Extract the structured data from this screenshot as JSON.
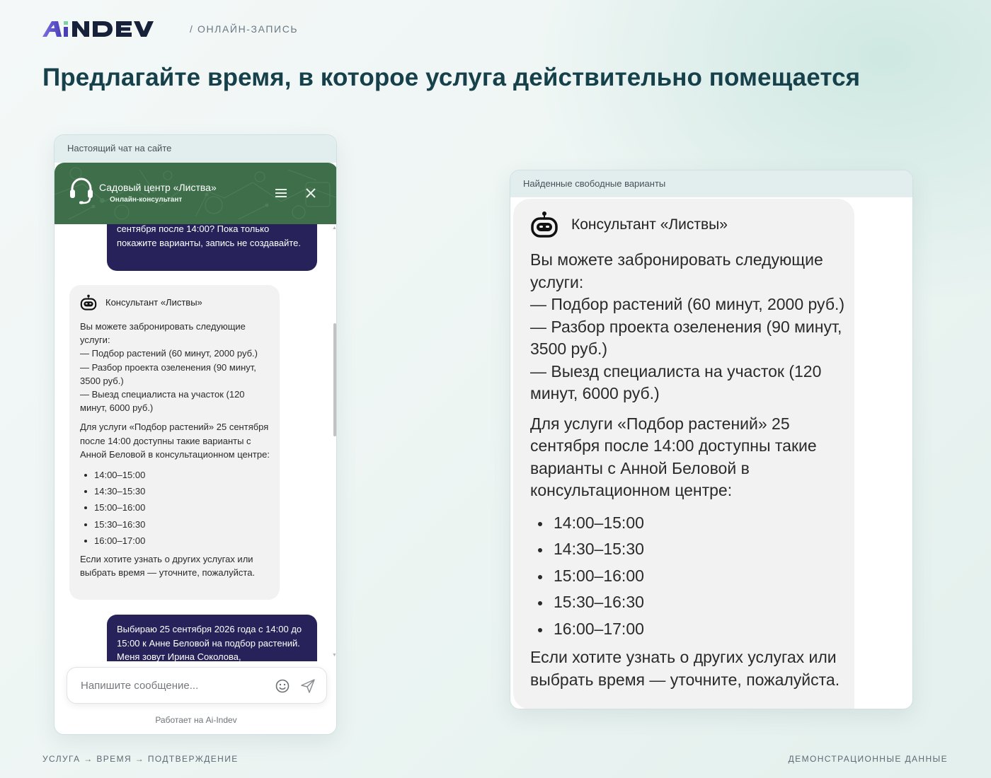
{
  "brand": {
    "logo_text": "AiNDEV",
    "crumb": "/ ОНЛАЙН-ЗАПИСЬ"
  },
  "headline": "Предлагайте время, в которое услуга действительно помещается",
  "left_card": {
    "label": "Настоящий чат на сайте",
    "chat": {
      "title": "Садовый центр «Листва»",
      "subtitle": "Онлайн-консультант",
      "user_message_1": "сентября после 14:00? Пока только покажите варианты, запись не создавайте.",
      "bot": {
        "name": "Консультант «Листвы»",
        "intro": "Вы можете забронировать следующие услуги:",
        "services": [
          "— Подбор растений (60 минут, 2000 руб.)",
          "— Разбор проекта озеленения (90 минут, 3500 руб.)",
          "— Выезд специалиста на участок (120 минут, 6000 руб.)"
        ],
        "availability": "Для услуги «Подбор растений» 25 сентября после 14:00 доступны такие варианты с Анной Беловой в консультационном центре:",
        "slots": [
          "14:00–15:00",
          "14:30–15:30",
          "15:00–16:00",
          "15:30–16:30",
          "16:00–17:00"
        ],
        "outro": "Если хотите узнать о других услугах или выбрать время — уточните, пожалуйста."
      },
      "user_message_2": "Выбираю 25 сентября 2026 года с 14:00 до 15:00 к Анне Беловой на подбор растений. Меня зовут Ирина Соколова,",
      "input_placeholder": "Напишите сообщение...",
      "powered_by": "Работает на Ai-Indev"
    }
  },
  "right_card": {
    "label": "Найденные свободные варианты"
  },
  "footer": {
    "left": "УСЛУГА → ВРЕМЯ → ПОДТВЕРЖДЕНИЕ",
    "right": "ДЕМОНСТРАЦИОННЫЕ ДАННЫЕ"
  },
  "colors": {
    "accent_dark": "#17414a",
    "chat_header_green": "#3e6e4a",
    "user_bubble": "#27225a",
    "bot_bubble": "#f2f2f2"
  },
  "icons": [
    "headset-icon",
    "menu-icon",
    "close-icon",
    "robot-icon",
    "emoji-icon",
    "send-icon"
  ]
}
